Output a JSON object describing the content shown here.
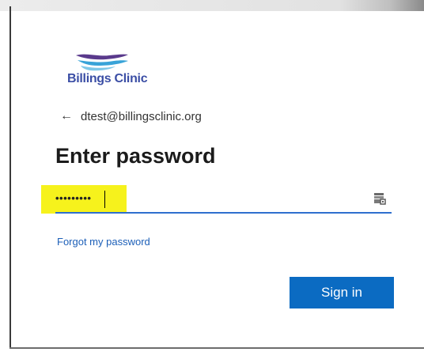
{
  "logo": {
    "text": "Billings Clinic",
    "colors": {
      "purple": "#3b4ea5",
      "teal": "#38a3d8",
      "violet": "#5a3a8c"
    }
  },
  "identity": {
    "back_icon": "back-arrow-icon",
    "email": "dtest@billingsclinic.org"
  },
  "heading": "Enter password",
  "password": {
    "masked_value": "•••••••••",
    "reveal_icon": "reveal-password-icon",
    "highlight_color": "#f6f21c",
    "underline_color": "#2f6fce"
  },
  "forgot_password": "Forgot my password",
  "sign_in": {
    "label": "Sign in",
    "color": "#0b6bc2"
  }
}
